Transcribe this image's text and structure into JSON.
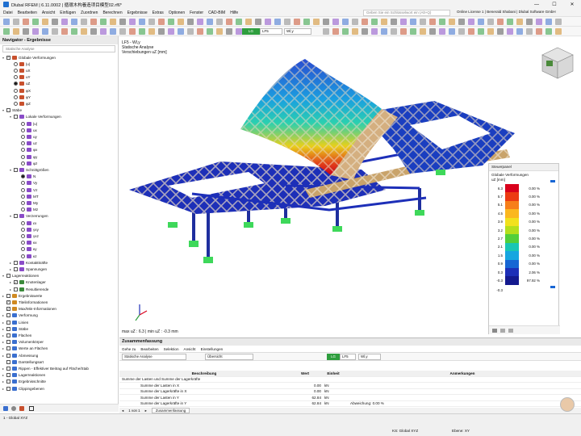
{
  "app": {
    "title": "Dlubal RFEM | 6.11.0002 | 循環木构養造项目模型02.rf6*",
    "window_controls": [
      "—",
      "☐",
      "✕"
    ]
  },
  "menu": {
    "items": [
      "Datei",
      "Bearbeiten",
      "Ansicht",
      "Einfügen",
      "Zuordnen",
      "Berechnen",
      "Ergebnisse",
      "Extras",
      "Optionen",
      "Fenster",
      "CAD-BIM",
      "Hilfe"
    ],
    "search_placeholder": "Geben Sie ein Schlüsselwort ein (Alt+Q)",
    "license": "Online License 1 | Benerald Shabani | Dlubal Software GmbH"
  },
  "toolbar": {
    "lc_badge": "LG",
    "lc_name": "LF5",
    "lc_desc": "Wl,y"
  },
  "navigator": {
    "title": "Navigator - Ergebnisse",
    "selector": "Statische Analyse",
    "tree": [
      {
        "d": 0,
        "ex": "v",
        "type": "cb",
        "chk": "✓",
        "label": "Globale Verformungen",
        "col": "#c8502d"
      },
      {
        "d": 1,
        "type": "rb",
        "on": false,
        "label": "|u|",
        "col": "#c8502d"
      },
      {
        "d": 1,
        "type": "rb",
        "on": false,
        "label": "uX",
        "col": "#c8502d"
      },
      {
        "d": 1,
        "type": "rb",
        "on": false,
        "label": "uY",
        "col": "#c8502d"
      },
      {
        "d": 1,
        "type": "rb",
        "on": true,
        "label": "uZ",
        "col": "#c8502d"
      },
      {
        "d": 1,
        "type": "rb",
        "on": false,
        "label": "φX",
        "col": "#c8502d"
      },
      {
        "d": 1,
        "type": "rb",
        "on": false,
        "label": "φY",
        "col": "#c8502d"
      },
      {
        "d": 1,
        "type": "rb",
        "on": false,
        "label": "φZ",
        "col": "#c8502d"
      },
      {
        "d": 0,
        "ex": "v",
        "type": "cb",
        "chk": "",
        "label": "Stäbe",
        "col": ""
      },
      {
        "d": 1,
        "ex": "v",
        "type": "cb",
        "chk": "",
        "label": "Lokale Verformungen",
        "col": "#8a4cc8"
      },
      {
        "d": 2,
        "type": "rb",
        "on": false,
        "label": "|u|",
        "col": "#8a4cc8"
      },
      {
        "d": 2,
        "type": "rb",
        "on": false,
        "label": "ux",
        "col": "#8a4cc8"
      },
      {
        "d": 2,
        "type": "rb",
        "on": false,
        "label": "uy",
        "col": "#8a4cc8"
      },
      {
        "d": 2,
        "type": "rb",
        "on": false,
        "label": "uz",
        "col": "#8a4cc8"
      },
      {
        "d": 2,
        "type": "rb",
        "on": false,
        "label": "φx",
        "col": "#8a4cc8"
      },
      {
        "d": 2,
        "type": "rb",
        "on": false,
        "label": "φy",
        "col": "#8a4cc8"
      },
      {
        "d": 2,
        "type": "rb",
        "on": false,
        "label": "φz",
        "col": "#8a4cc8"
      },
      {
        "d": 1,
        "ex": "v",
        "type": "cb",
        "chk": "",
        "label": "Schnittgrößen",
        "col": "#8a4cc8"
      },
      {
        "d": 2,
        "type": "rb",
        "on": true,
        "label": "N",
        "col": "#8a4cc8"
      },
      {
        "d": 2,
        "type": "rb",
        "on": false,
        "label": "Vy",
        "col": "#8a4cc8"
      },
      {
        "d": 2,
        "type": "rb",
        "on": false,
        "label": "Vz",
        "col": "#8a4cc8"
      },
      {
        "d": 2,
        "type": "rb",
        "on": false,
        "label": "MT",
        "col": "#8a4cc8"
      },
      {
        "d": 2,
        "type": "rb",
        "on": false,
        "label": "My",
        "col": "#8a4cc8"
      },
      {
        "d": 2,
        "type": "rb",
        "on": false,
        "label": "Mz",
        "col": "#8a4cc8"
      },
      {
        "d": 1,
        "ex": "v",
        "type": "cb",
        "chk": "",
        "label": "Verzerrungen",
        "col": "#8a4cc8"
      },
      {
        "d": 2,
        "type": "rb",
        "on": false,
        "label": "εx",
        "col": "#8a4cc8"
      },
      {
        "d": 2,
        "type": "rb",
        "on": false,
        "label": "γxy",
        "col": "#8a4cc8"
      },
      {
        "d": 2,
        "type": "rb",
        "on": false,
        "label": "γxz",
        "col": "#8a4cc8"
      },
      {
        "d": 2,
        "type": "rb",
        "on": false,
        "label": "κx",
        "col": "#8a4cc8"
      },
      {
        "d": 2,
        "type": "rb",
        "on": false,
        "label": "κy",
        "col": "#8a4cc8"
      },
      {
        "d": 2,
        "type": "rb",
        "on": false,
        "label": "κz",
        "col": "#8a4cc8"
      },
      {
        "d": 1,
        "ex": ">",
        "type": "cb",
        "chk": "",
        "label": "Kontaktkräfte",
        "col": "#8a4cc8"
      },
      {
        "d": 1,
        "ex": ">",
        "type": "cb",
        "chk": "",
        "label": "Spannungen",
        "col": "#8a4cc8"
      },
      {
        "d": 0,
        "ex": "v",
        "type": "cb",
        "chk": "",
        "label": "Lagerreaktionen",
        "col": ""
      },
      {
        "d": 1,
        "ex": ">",
        "type": "cb",
        "chk": "✓",
        "label": "Knotenlager",
        "col": "#3b8a3b"
      },
      {
        "d": 1,
        "ex": ">",
        "type": "cb",
        "chk": "",
        "label": "Resultierende",
        "col": "#3b8a3b"
      },
      {
        "d": 0,
        "ex": ">",
        "type": "cb",
        "chk": "",
        "label": "Ergebniswerte",
        "col": "#d08a22"
      },
      {
        "d": 0,
        "ex": "",
        "type": "cb",
        "chk": "✓",
        "label": "Titelinformationen",
        "col": "#d08a22"
      },
      {
        "d": 0,
        "ex": "",
        "type": "cb",
        "chk": "✓",
        "label": "Max/Min-Informationen",
        "col": "#d08a22"
      },
      {
        "d": 0,
        "ex": ">",
        "type": "cb",
        "chk": "",
        "label": "Verformung",
        "col": "#3a6fcf"
      },
      {
        "d": 0,
        "ex": ">",
        "type": "cb",
        "chk": "",
        "label": "Linien",
        "col": "#3a6fcf"
      },
      {
        "d": 0,
        "ex": ">",
        "type": "cb",
        "chk": "",
        "label": "Stäbe",
        "col": "#3a6fcf"
      },
      {
        "d": 0,
        "ex": ">",
        "type": "cb",
        "chk": "",
        "label": "Flächen",
        "col": "#3a6fcf"
      },
      {
        "d": 0,
        "ex": ">",
        "type": "cb",
        "chk": "",
        "label": "Volumenkörper",
        "col": "#3a6fcf"
      },
      {
        "d": 0,
        "ex": ">",
        "type": "cb",
        "chk": "",
        "label": "Werte an Flächen",
        "col": "#3a6fcf"
      },
      {
        "d": 0,
        "ex": ">",
        "type": "cb",
        "chk": "",
        "label": "Abmessung",
        "col": "#3a6fcf"
      },
      {
        "d": 0,
        "ex": "",
        "type": "cb",
        "chk": "",
        "label": "Darstellungsart",
        "col": "#3a6fcf"
      },
      {
        "d": 0,
        "ex": ">",
        "type": "cb",
        "chk": "",
        "label": "Rippen - Effektiver Beitrag auf Fläche/Stab",
        "col": "#3a6fcf"
      },
      {
        "d": 0,
        "ex": ">",
        "type": "cb",
        "chk": "",
        "label": "Lagerreaktionen",
        "col": "#3a6fcf"
      },
      {
        "d": 0,
        "ex": ">",
        "type": "cb",
        "chk": "",
        "label": "Ergebnisschnitte",
        "col": "#3a6fcf"
      },
      {
        "d": 0,
        "ex": ">",
        "type": "cb",
        "chk": "",
        "label": "Clippingebenen",
        "col": "#3a6fcf"
      }
    ]
  },
  "view": {
    "lc": "LF5 - Wl,y",
    "analysis": "Statische Analyse",
    "quantity": "Verschiebungen uZ [mm]",
    "maxmin": "max uZ : 6.3 | min uZ : -0.3 mm"
  },
  "control_panel": {
    "title": "Steuerpanel",
    "heading": "Globale Verformungen",
    "unit": "uZ [mm]",
    "legend": [
      {
        "v": "6.3",
        "color": "#d9001b",
        "pct": "0.00 %"
      },
      {
        "v": "5.7",
        "color": "#ec3b12",
        "pct": "0.00 %"
      },
      {
        "v": "5.1",
        "color": "#f77f1a",
        "pct": "0.00 %"
      },
      {
        "v": "4.5",
        "color": "#fbb71f",
        "pct": "0.00 %"
      },
      {
        "v": "3.9",
        "color": "#f2e11d",
        "pct": "0.00 %"
      },
      {
        "v": "3.2",
        "color": "#b5df1c",
        "pct": "0.00 %"
      },
      {
        "v": "2.7",
        "color": "#52cf3a",
        "pct": "0.00 %"
      },
      {
        "v": "2.1",
        "color": "#19c6b4",
        "pct": "0.00 %"
      },
      {
        "v": "1.5",
        "color": "#17a6e0",
        "pct": "0.00 %"
      },
      {
        "v": "0.9",
        "color": "#1766d4",
        "pct": "0.00 %"
      },
      {
        "v": "0.3",
        "color": "#1d2fb8",
        "pct": "2.06 %"
      },
      {
        "v": "-0.3",
        "color": "#141a8f",
        "pct": "97.92 %"
      }
    ],
    "bottom_value": "-0.3"
  },
  "summary": {
    "title": "Zusammenfassung",
    "menu": [
      "Gehe zu",
      "Bearbeiten",
      "Selektion",
      "Ansicht",
      "Einstellungen"
    ],
    "analysis": "Statische Analyse",
    "overview": "Übersicht",
    "lc_badge": "LG",
    "lc_name": "LF5",
    "lc_desc": "Wl,y",
    "columns": [
      "Beschreibung",
      "Wert",
      "Einheit",
      "Anmerkungen"
    ],
    "group": "Summe der Lasten und Summe der Lagerkräfte",
    "rows": [
      {
        "d": "Summe der Lasten in X",
        "v": "0.00",
        "u": "kN",
        "n": ""
      },
      {
        "d": "Summe der Lagerkräfte in X",
        "v": "0.00",
        "u": "kN",
        "n": ""
      },
      {
        "d": "Summe der Lasten in Y",
        "v": "62.84",
        "u": "kN",
        "n": ""
      },
      {
        "d": "Summe der Lagerkräfte in Y",
        "v": "62.84",
        "u": "kN",
        "n": "Abweichung: 0.00 %"
      },
      {
        "d": "Summe der Lasten in Z",
        "v": "0.00",
        "u": "kN",
        "n": ""
      },
      {
        "d": "Summe der Lagerkräfte in Z",
        "v": "255.48",
        "u": "kN",
        "n": ""
      }
    ],
    "pager": "1 von 1",
    "tab": "Zusammenfassung"
  },
  "status": {
    "cs": "1 - Global XYZ",
    "ks": "KS: Global XYZ",
    "plane": "Ebene: XY"
  }
}
